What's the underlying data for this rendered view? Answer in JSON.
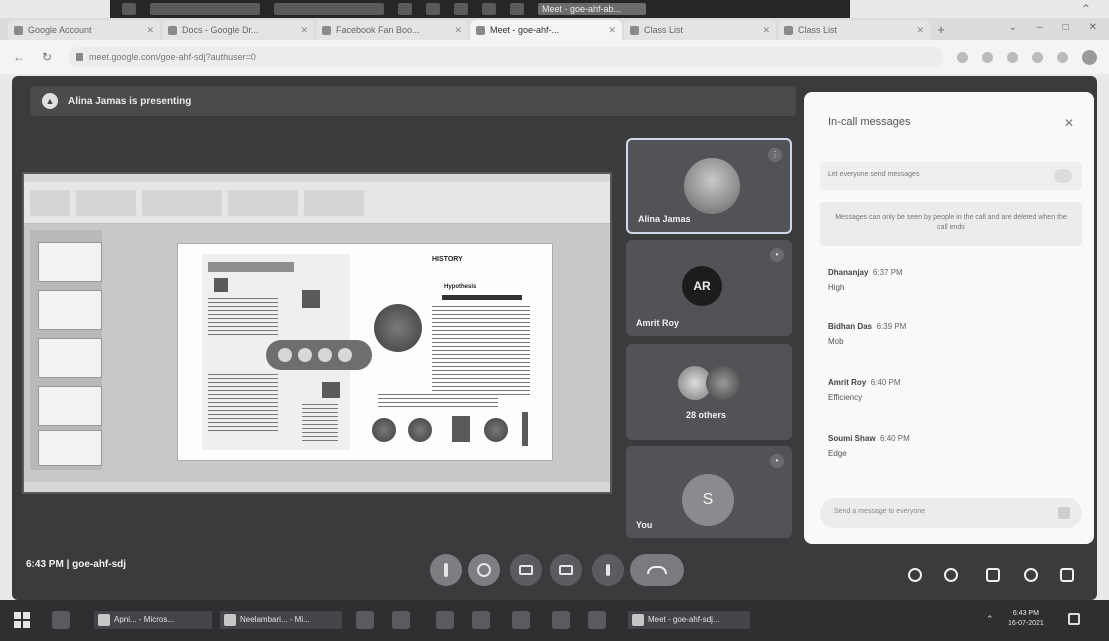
{
  "top_taskbar": {
    "active_item": "Meet - goe-ahf-ab..."
  },
  "browser": {
    "tabs": [
      {
        "label": "Google Account"
      },
      {
        "label": "Docs - Google Dr..."
      },
      {
        "label": "Facebook Fan Boo..."
      },
      {
        "label": "Meet - goe-ahf-..."
      },
      {
        "label": "Class List"
      },
      {
        "label": "Class List"
      }
    ],
    "url": "meet.google.com/goe-ahf-sdj?authuser=0"
  },
  "meet": {
    "presenting_text": "Alina Jamas is presenting",
    "meeting_info": "6:43 PM  |  goe-ahf-sdj",
    "tiles": [
      {
        "name": "Alina Jamas",
        "initials": ""
      },
      {
        "name": "Amrit Roy",
        "initials": "AR"
      },
      {
        "name": "28 others",
        "initials": ""
      },
      {
        "name": "You",
        "initials": "S"
      }
    ],
    "slide": {
      "title_top": "HISTORY",
      "subtitle": "Hypothesis"
    }
  },
  "chat": {
    "title": "In-call messages",
    "toggle_label": "Let everyone send messages",
    "notice": "Messages can only be seen by people in the call and are deleted when the call ends",
    "messages": [
      {
        "sender": "Dhananjay",
        "time": "6:37 PM",
        "text": "High"
      },
      {
        "sender": "Bidhan Das",
        "time": "6:39 PM",
        "text": "Mob"
      },
      {
        "sender": "Amrit Roy",
        "time": "6:40 PM",
        "text": "Efficiency"
      },
      {
        "sender": "Soumi Shaw",
        "time": "6:40 PM",
        "text": "Edge"
      }
    ],
    "input_placeholder": "Send a message to everyone"
  },
  "taskbar": {
    "items": [
      {
        "label": "Apni... - Micros..."
      },
      {
        "label": "Neelambari... - Mi..."
      },
      {
        "label": "Meet - goe-ahf-sdj..."
      }
    ],
    "clock_time": "6:43 PM",
    "clock_date": "16-07-2021"
  }
}
